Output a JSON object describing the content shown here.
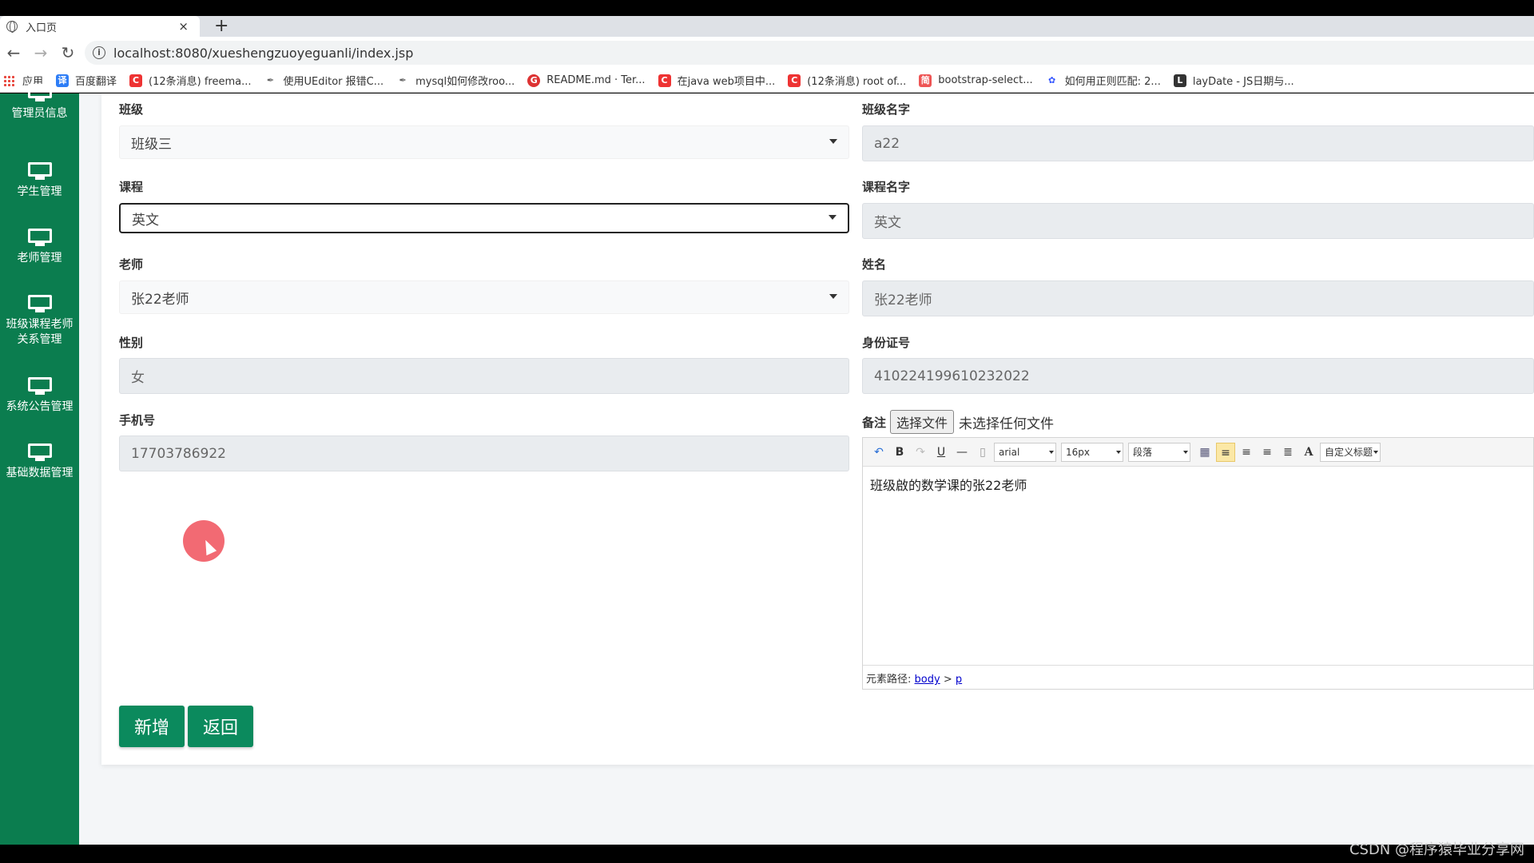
{
  "browser": {
    "tab_title": "入口页",
    "tab_close": "×",
    "new_tab": "+",
    "url": "localhost:8080/xueshengzuoyeguanli/index.jsp",
    "bookmarks": [
      {
        "label": "应用",
        "icon_char": "",
        "color": "#e8453c"
      },
      {
        "label": "百度翻译",
        "icon_char": "译",
        "color": "#2d7df6"
      },
      {
        "label": "(12条消息) freema...",
        "icon_char": "C",
        "color": "#e33"
      },
      {
        "label": "使用UEditor 报错C...",
        "icon_char": "✒",
        "color": "#666"
      },
      {
        "label": "mysql如何修改roo...",
        "icon_char": "✒",
        "color": "#666"
      },
      {
        "label": "README.md · Ter...",
        "icon_char": "G",
        "color": "#d92"
      },
      {
        "label": "在java web项目中...",
        "icon_char": "C",
        "color": "#e33"
      },
      {
        "label": "(12条消息) root of...",
        "icon_char": "C",
        "color": "#e33"
      },
      {
        "label": "bootstrap-select...",
        "icon_char": "简",
        "color": "#e55"
      },
      {
        "label": "如何用正则匹配: 2...",
        "icon_char": "✿",
        "color": "#35f"
      },
      {
        "label": "layDate - JS日期与...",
        "icon_char": "L",
        "color": "#333"
      }
    ]
  },
  "sidebar": {
    "items": [
      {
        "label": "管理员信息"
      },
      {
        "label": "学生管理"
      },
      {
        "label": "老师管理"
      },
      {
        "label": "班级课程老师关系管理"
      },
      {
        "label": "系统公告管理"
      },
      {
        "label": "基础数据管理"
      }
    ]
  },
  "form": {
    "class_label": "班级",
    "class_value": "班级三",
    "class_name_label": "班级名字",
    "class_name_value": "a22",
    "course_label": "课程",
    "course_value": "英文",
    "course_name_label": "课程名字",
    "course_name_value": "英文",
    "teacher_label": "老师",
    "teacher_value": "张22老师",
    "name_label": "姓名",
    "name_value": "张22老师",
    "gender_label": "性别",
    "gender_value": "女",
    "id_label": "身份证号",
    "id_value": "410224199610232022",
    "phone_label": "手机号",
    "phone_value": "17703786922",
    "remark_label": "备注",
    "file_button": "选择文件",
    "file_status": "未选择任何文件"
  },
  "editor": {
    "font": "arial",
    "size": "16px",
    "block": "段落",
    "custom_title": "自定义标题",
    "content": "班级啟的数学课的张22老师",
    "path_label": "元素路径:",
    "path_body": "body",
    "path_sep": ">",
    "path_p": "p"
  },
  "buttons": {
    "add": "新增",
    "back": "返回"
  },
  "watermark": "CSDN @程序猿毕业分享网"
}
